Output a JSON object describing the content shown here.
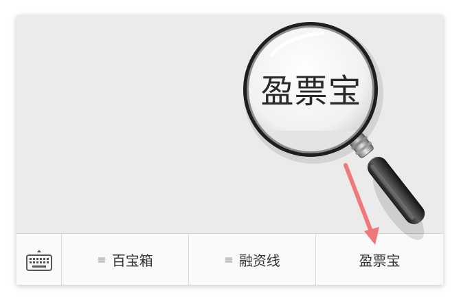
{
  "menu": {
    "keyboard_icon": "keyboard-icon",
    "items": [
      {
        "label": "百宝箱",
        "icon": "menu-lines-icon"
      },
      {
        "label": "融资线",
        "icon": "menu-lines-icon"
      },
      {
        "label": "盈票宝"
      }
    ]
  },
  "magnifier": {
    "text": "盈票宝",
    "icon": "magnifier-icon"
  },
  "arrow": {
    "color": "#f07878"
  }
}
